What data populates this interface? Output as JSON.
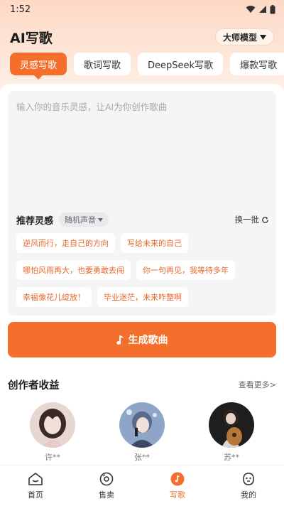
{
  "status_bar": {
    "time": "1:52"
  },
  "header": {
    "title": "AI写歌",
    "model_label": "大师模型"
  },
  "tabs": [
    {
      "label": "灵感写歌",
      "active": true
    },
    {
      "label": "歌词写歌",
      "active": false
    },
    {
      "label": "DeepSeek写歌",
      "active": false
    },
    {
      "label": "爆款写歌",
      "active": false
    }
  ],
  "input": {
    "placeholder": "输入你的音乐灵感，让AI为你创作歌曲"
  },
  "inspiration": {
    "title": "推荐灵感",
    "voice_label": "随机声音",
    "refresh_label": "换一批",
    "chips": [
      "逆风而行，走自己的方向",
      "写给未来的自己",
      "哪怕风雨再大，也要勇敢去闯",
      "你一句再见，我等待多年",
      "幸福像花儿绽放！",
      "毕业迷茫，未来咋整啊"
    ]
  },
  "generate_button": {
    "label": "生成歌曲"
  },
  "creators_section": {
    "title": "创作者收益",
    "see_more": "查看更多>",
    "creators": [
      {
        "name": "许**"
      },
      {
        "name": "张**"
      },
      {
        "name": "苏**"
      }
    ]
  },
  "bottom_nav": [
    {
      "label": "首页",
      "icon": "home-icon",
      "active": false
    },
    {
      "label": "售卖",
      "icon": "vinyl-icon",
      "active": false
    },
    {
      "label": "写歌",
      "icon": "music-note-icon",
      "active": true
    },
    {
      "label": "我的",
      "icon": "profile-face-icon",
      "active": false
    }
  ],
  "colors": {
    "accent": "#f36f2b",
    "chip_text": "#e8672a"
  }
}
